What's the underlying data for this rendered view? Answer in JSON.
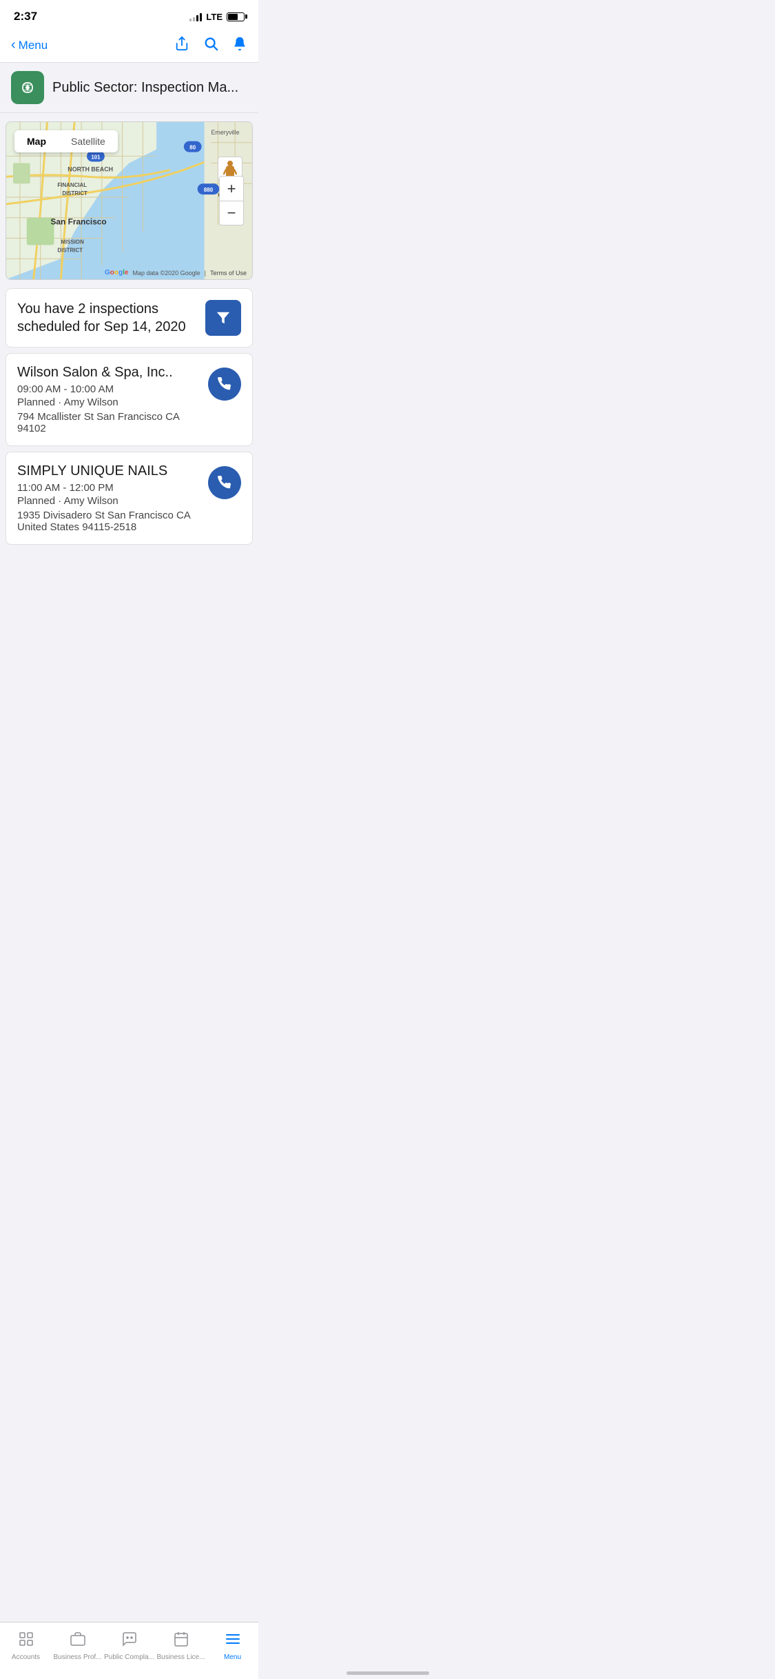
{
  "statusBar": {
    "time": "2:37",
    "signal": "LTE"
  },
  "nav": {
    "backLabel": "Menu",
    "shareIcon": "share",
    "searchIcon": "search",
    "notificationIcon": "bell"
  },
  "appHeader": {
    "title": "Public Sector: Inspection Ma..."
  },
  "map": {
    "toggleOptions": [
      "Map",
      "Satellite"
    ],
    "activeToggle": "Map",
    "zoomIn": "+",
    "zoomOut": "−",
    "attribution": "Map data ©2020 Google",
    "termsLabel": "Terms of Use",
    "location": "San Francisco"
  },
  "inspectionsSummary": {
    "text": "You have 2 inspections scheduled for Sep 14, 2020",
    "filterIcon": "filter"
  },
  "inspections": [
    {
      "id": "inspection-1",
      "name": "Wilson Salon & Spa, Inc..",
      "time": "09:00 AM - 10:00 AM",
      "status": "Planned",
      "agent": "Amy Wilson",
      "address": "794 Mcallister St San Francisco CA 94102"
    },
    {
      "id": "inspection-2",
      "name": "SIMPLY UNIQUE NAILS",
      "time": "11:00 AM - 12:00 PM",
      "status": "Planned",
      "agent": "Amy Wilson",
      "address": "1935 Divisadero St San Francisco CA United States 94115-2518"
    }
  ],
  "tabs": [
    {
      "id": "accounts",
      "label": "Accounts",
      "icon": "grid",
      "active": false
    },
    {
      "id": "business-prof",
      "label": "Business Prof...",
      "icon": "briefcase",
      "active": false
    },
    {
      "id": "public-compla",
      "label": "Public Compla...",
      "icon": "chat",
      "active": false
    },
    {
      "id": "business-lice",
      "label": "Business Lice...",
      "icon": "calendar",
      "active": false
    },
    {
      "id": "menu",
      "label": "Menu",
      "icon": "menu",
      "active": true
    }
  ]
}
